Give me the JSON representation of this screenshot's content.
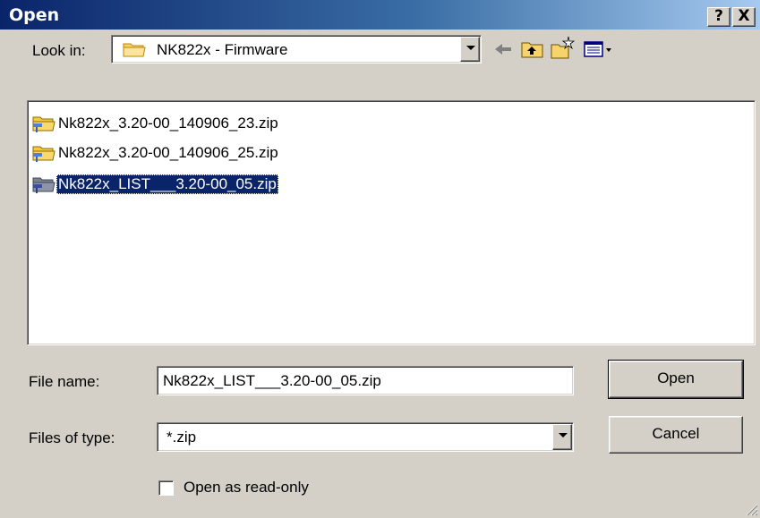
{
  "window": {
    "title": "Open",
    "help_label": "?",
    "close_label": "X"
  },
  "look_in": {
    "label": "Look in:",
    "value": "NK822x - Firmware",
    "folder_icon": "folder-icon"
  },
  "toolbar": {
    "back_icon": "back-arrow-icon",
    "up_icon": "up-one-level-icon",
    "new_folder_icon": "new-folder-icon",
    "view_menu_icon": "view-menu-icon"
  },
  "files": [
    {
      "name": "Nk822x_3.20-00_140906_23.zip",
      "icon": "zip-folder-icon",
      "selected": false
    },
    {
      "name": "Nk822x_3.20-00_140906_25.zip",
      "icon": "zip-folder-icon",
      "selected": false
    },
    {
      "name": "Nk822x_LIST___3.20-00_05.zip",
      "icon": "zip-folder-icon",
      "selected": true
    }
  ],
  "file_name": {
    "label": "File name:",
    "value": "Nk822x_LIST___3.20-00_05.zip"
  },
  "file_type": {
    "label": "Files of type:",
    "value": "*.zip"
  },
  "read_only": {
    "label": "Open as read-only",
    "checked": false
  },
  "buttons": {
    "open": "Open",
    "cancel": "Cancel"
  },
  "colors": {
    "title_bar": "#0a246a",
    "selection": "#0a246a",
    "face": "#d4d0c8"
  }
}
